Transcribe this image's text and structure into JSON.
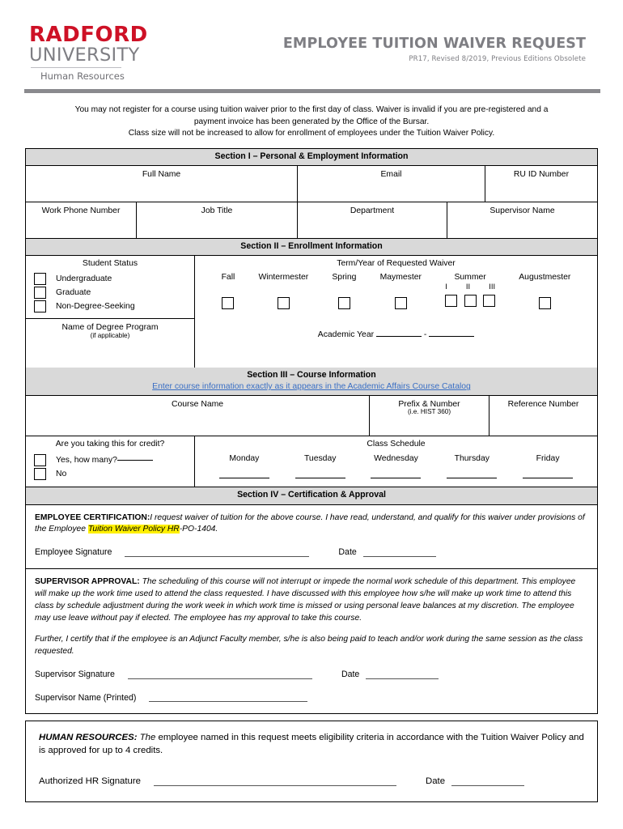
{
  "header": {
    "logo": {
      "line1": "RADFORD",
      "line2": "UNIVERSITY",
      "line3": "Human Resources",
      "red": "#CE1126",
      "gray": "#7E7E83"
    },
    "title": "EMPLOYEE TUITION WAIVER REQUEST",
    "subtitle": "PR17, Revised 8/2019, Previous Editions Obsolete"
  },
  "intro": {
    "line1": "You may not register for a course using tuition waiver prior to the first day of class.  Waiver is invalid if you are pre-registered and a",
    "line2": "payment invoice has been generated by the Office of the Bursar.",
    "line3": "Class size will not be increased to allow for enrollment of employees under the Tuition Waiver Policy."
  },
  "section1": {
    "heading": "Section I – Personal & Employment Information",
    "row1": [
      "Full Name",
      "Email",
      "RU ID Number"
    ],
    "row2": [
      "Work Phone Number",
      "Job Title",
      "Department",
      "Supervisor Name"
    ]
  },
  "section2": {
    "heading": "Section II – Enrollment Information",
    "student_status_label": "Student Status",
    "student_status_options": [
      "Undergraduate",
      "Graduate",
      "Non-Degree-Seeking"
    ],
    "degree_program_label": "Name of Degree Program",
    "degree_program_sublabel": "(if applicable)",
    "term_label": "Term/Year of Requested Waiver",
    "terms": [
      "Fall",
      "Wintermester",
      "Spring",
      "Maymester"
    ],
    "summer_label": "Summer",
    "summer_parts": [
      "I",
      "II",
      "III"
    ],
    "augustmester_label": "Augustmester",
    "academic_year_label": "Academic Year",
    "academic_year_dash": "-"
  },
  "section3": {
    "heading": "Section III – Course Information",
    "link": "Enter course information exactly as it appears in the Academic Affairs Course Catalog",
    "link_color": "#3a6fc4",
    "columns": [
      "Course Name",
      "Prefix & Number",
      "Reference Number"
    ],
    "prefix_sublabel": "(i.e. HIST 360)",
    "credit_question": "Are you taking this for credit?",
    "credit_yes": "Yes, how many?",
    "credit_no": "No",
    "schedule_label": "Class Schedule",
    "days": [
      "Monday",
      "Tuesday",
      "Wednesday",
      "Thursday",
      "Friday"
    ]
  },
  "section4": {
    "heading": "Section IV – Certification & Approval",
    "employee": {
      "title": "EMPLOYEE CERTIFICATION:",
      "body_part1": "I request waiver of tuition for the above course. I have read, understand, and qualify for this waiver under provisions of the Employee ",
      "highlight": "Tuition Waiver Policy HR",
      "body_part2": "-PO-1404.",
      "signature_label": "Employee Signature",
      "date_label": "Date"
    },
    "supervisor": {
      "title": "SUPERVISOR APPROVAL:",
      "paragraph1": "The scheduling of this course will not interrupt or impede the normal work schedule of this department. This employee will make up the work time used to attend the class requested.  I have discussed with this employee how s/he will make up work time to attend this class by schedule adjustment during the work week in which work time is missed or using personal leave balances at my discretion.  The employee may use leave without pay if elected.  The employee has my approval to take this course.",
      "paragraph2": "Further, I certify that if the employee is an Adjunct Faculty member, s/he is also being paid to teach and/or work during the same session as the class requested.",
      "signature_label": "Supervisor Signature",
      "date_label": "Date",
      "printed_name_label": "Supervisor Name (Printed)"
    }
  },
  "hr_section": {
    "title": "HUMAN RESOURCES:",
    "emphasis": "The",
    "body": " employee named in this request meets eligibility criteria in accordance with the Tuition Waiver Policy and is approved for up to 4 credits.",
    "signature_label": "Authorized HR Signature",
    "date_label": "Date"
  }
}
